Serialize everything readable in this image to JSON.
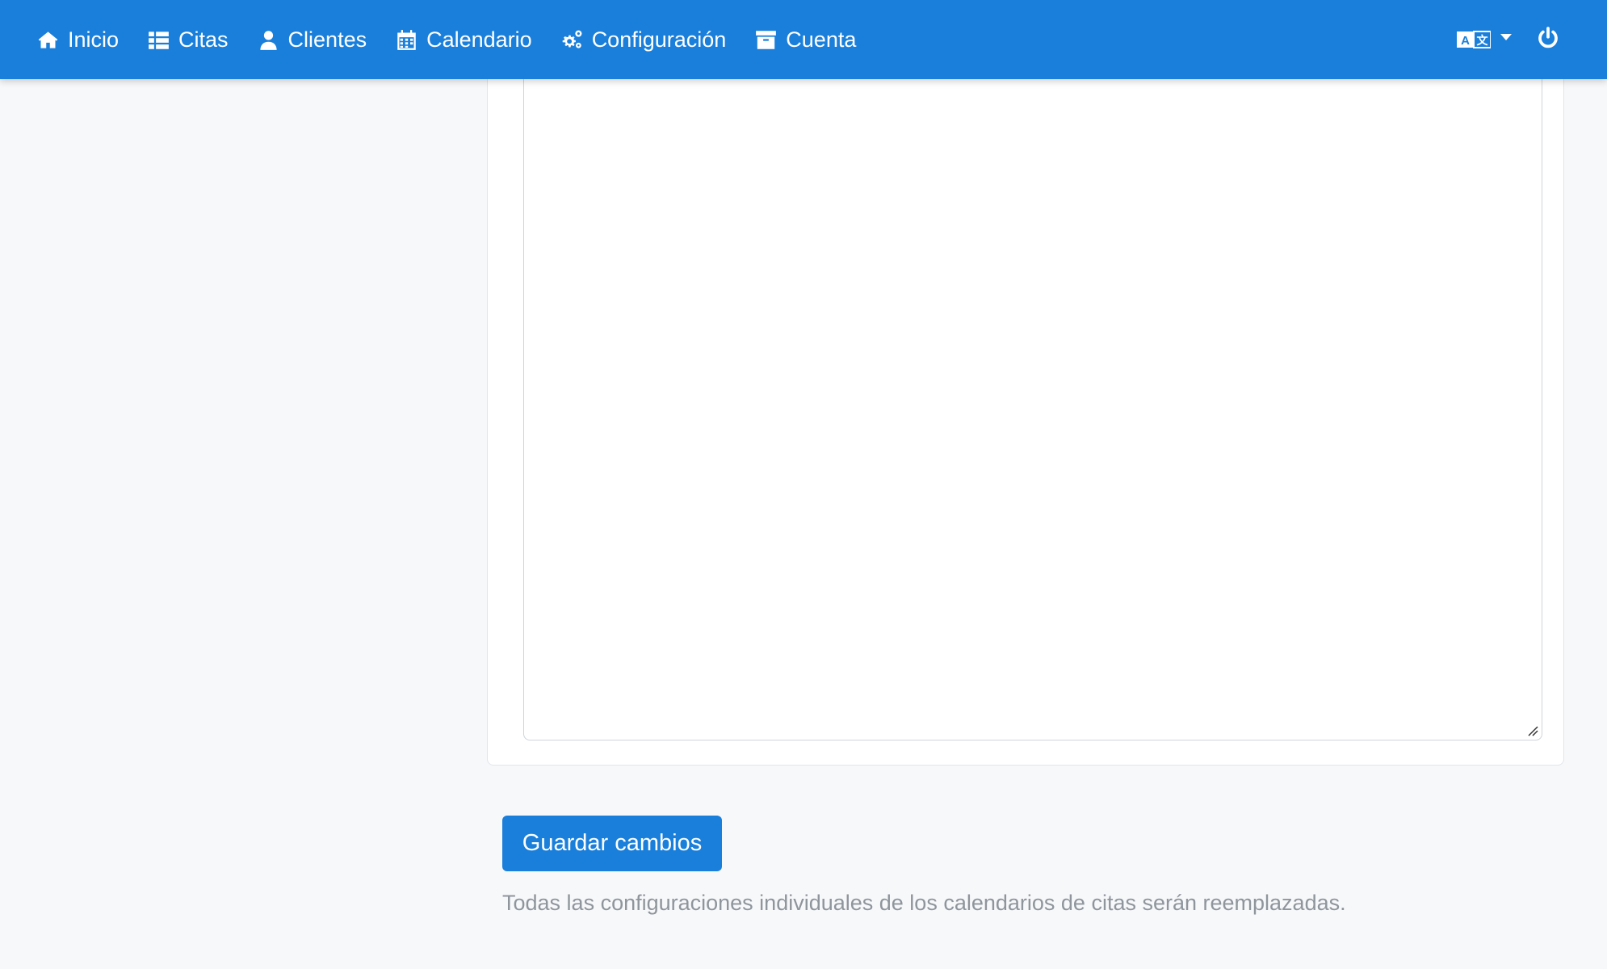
{
  "nav": {
    "items": [
      {
        "label": "Inicio",
        "icon": "home-icon"
      },
      {
        "label": "Citas",
        "icon": "list-icon"
      },
      {
        "label": "Clientes",
        "icon": "user-icon"
      },
      {
        "label": "Calendario",
        "icon": "calendar-icon"
      },
      {
        "label": "Configuración",
        "icon": "cogs-icon"
      },
      {
        "label": "Cuenta",
        "icon": "archive-icon"
      }
    ],
    "language_icon": "language-icon",
    "logout_icon": "power-icon"
  },
  "editor": {
    "value": ""
  },
  "actions": {
    "save_label": "Guardar cambios",
    "note": "Todas las configuraciones individuales de los calendarios de citas serán reemplazadas."
  },
  "colors": {
    "primary": "#1a7fdb",
    "background": "#f7f8fa",
    "muted_text": "#8e959c"
  }
}
